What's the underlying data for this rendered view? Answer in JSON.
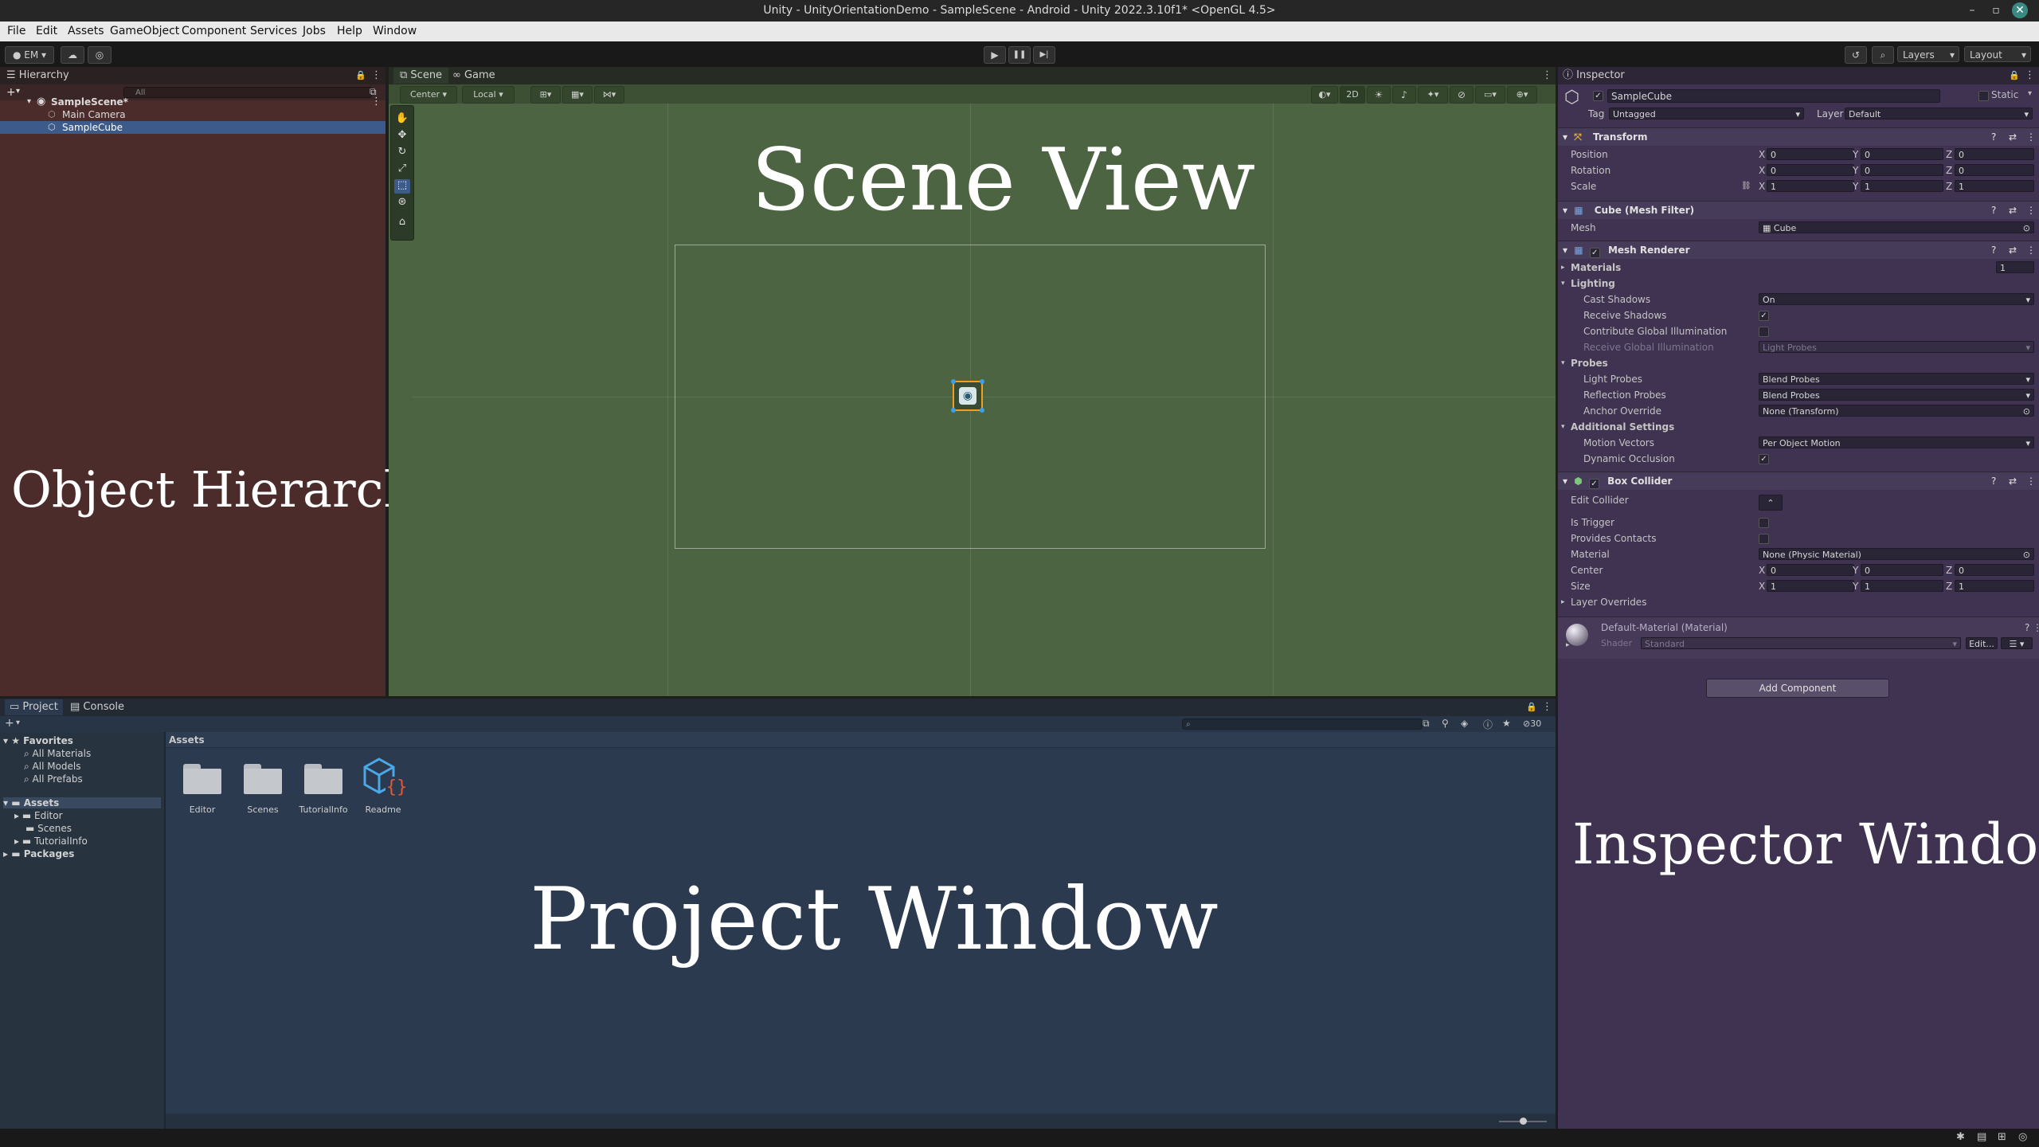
{
  "window": {
    "title": "Unity - UnityOrientationDemo - SampleScene - Android - Unity 2022.3.10f1* <OpenGL 4.5>",
    "controls": [
      "–",
      "▫",
      "✕"
    ]
  },
  "menu": [
    "File",
    "Edit",
    "Assets",
    "GameObject",
    "Component",
    "Services",
    "Jobs",
    "Help",
    "Window"
  ],
  "toolbar": {
    "account": "EM",
    "play_icon": "▶",
    "pause_icon": "❚❚",
    "step_icon": "▶|",
    "layers": "Layers",
    "layout": "Layout"
  },
  "hierarchy": {
    "tab": "Hierarchy",
    "search_placeholder": "All",
    "add": "+",
    "scene": "SampleScene*",
    "items": [
      "Main Camera",
      "SampleCube"
    ],
    "overlay_label": "Object Hierarchy",
    "color": "#4c2b2b"
  },
  "scene_view": {
    "tabs": [
      "Scene",
      "Game"
    ],
    "pivot": "Center",
    "space": "Local",
    "mode_2d": "2D",
    "overlay_label": "Scene View",
    "color": "#4c6441"
  },
  "project": {
    "tabs": [
      "Project",
      "Console"
    ],
    "add": "+",
    "favorites_label": "Favorites",
    "favorites": [
      "All Materials",
      "All Models",
      "All Prefabs"
    ],
    "assets_label": "Assets",
    "asset_folders": [
      "Editor",
      "Scenes",
      "TutorialInfo"
    ],
    "packages_label": "Packages",
    "breadcrumb": "Assets",
    "grid_items": [
      "Editor",
      "Scenes",
      "TutorialInfo",
      "Readme"
    ],
    "hidden_count": "30",
    "overlay_label": "Project Window",
    "color": "#2b3a4e"
  },
  "inspector": {
    "tab": "Inspector",
    "object_name": "SampleCube",
    "static_label": "Static",
    "tag_label": "Tag",
    "tag_value": "Untagged",
    "layer_label": "Layer",
    "layer_value": "Default",
    "transform": {
      "title": "Transform",
      "position_label": "Position",
      "rotation_label": "Rotation",
      "scale_label": "Scale",
      "position": [
        "0",
        "0",
        "0"
      ],
      "rotation": [
        "0",
        "0",
        "0"
      ],
      "scale": [
        "1",
        "1",
        "1"
      ]
    },
    "mesh_filter": {
      "title": "Cube (Mesh Filter)",
      "mesh_label": "Mesh",
      "mesh_value": "Cube"
    },
    "mesh_renderer": {
      "title": "Mesh Renderer",
      "materials_label": "Materials",
      "materials_count": "1",
      "lighting_label": "Lighting",
      "cast_shadows_label": "Cast Shadows",
      "cast_shadows_value": "On",
      "receive_shadows_label": "Receive Shadows",
      "contribute_gi_label": "Contribute Global Illumination",
      "receive_gi_label": "Receive Global Illumination",
      "receive_gi_value": "Light Probes",
      "probes_label": "Probes",
      "light_probes_label": "Light Probes",
      "light_probes_value": "Blend Probes",
      "reflection_probes_label": "Reflection Probes",
      "reflection_probes_value": "Blend Probes",
      "anchor_override_label": "Anchor Override",
      "anchor_override_value": "None (Transform)",
      "additional_label": "Additional Settings",
      "motion_vectors_label": "Motion Vectors",
      "motion_vectors_value": "Per Object Motion",
      "dynamic_occlusion_label": "Dynamic Occlusion"
    },
    "box_collider": {
      "title": "Box Collider",
      "edit_collider_label": "Edit Collider",
      "is_trigger_label": "Is Trigger",
      "provides_contacts_label": "Provides Contacts",
      "material_label": "Material",
      "material_value": "None (Physic Material)",
      "center_label": "Center",
      "size_label": "Size",
      "center": [
        "0",
        "0",
        "0"
      ],
      "size": [
        "1",
        "1",
        "1"
      ],
      "layer_overrides_label": "Layer Overrides"
    },
    "material": {
      "name": "Default-Material (Material)",
      "shader_label": "Shader",
      "shader_value": "Standard",
      "edit_label": "Edit..."
    },
    "add_component": "Add Component",
    "axis": [
      "X",
      "Y",
      "Z"
    ],
    "overlay_label": "Inspector Window",
    "color": "#3f3351"
  }
}
